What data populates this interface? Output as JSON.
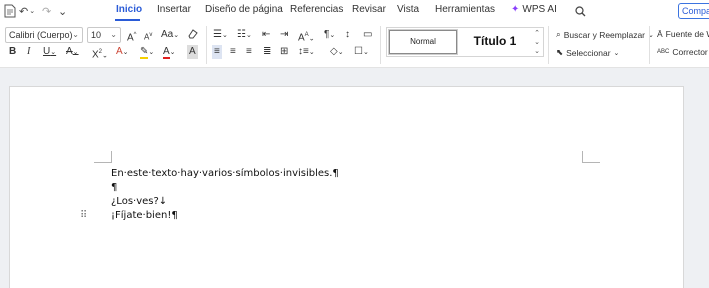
{
  "quick_access": {
    "doc_icon": "document-icon",
    "undo_icon": "undo-icon",
    "redo_icon": "redo-icon",
    "more_icon": "chevron-down-icon"
  },
  "tabs": [
    {
      "label": "Inicio",
      "active": true
    },
    {
      "label": "Insertar"
    },
    {
      "label": "Diseño de página"
    },
    {
      "label": "Referencias"
    },
    {
      "label": "Revisar"
    },
    {
      "label": "Vista"
    },
    {
      "label": "Herramientas"
    }
  ],
  "wps_ai": {
    "label": "WPS AI"
  },
  "share": {
    "label": "Compartir"
  },
  "font": {
    "family": "Calibri (Cuerpo)",
    "size": "10"
  },
  "styles": {
    "normal": "Normal",
    "title1": "Título 1"
  },
  "editing": {
    "find_replace": "Buscar y Reemplazar",
    "select": "Seleccionar",
    "font_source": "Fuente de W",
    "spell": "Corrector or"
  },
  "document": {
    "lines": [
      "En·este·texto·hay·varios·símbolos·invisibles.¶",
      "¶",
      "¿Los·ves?↓",
      "¡Fíjate·bien!¶"
    ]
  },
  "colors": {
    "accent": "#2a5bd7",
    "ai_sparkle": "#8a3ffc"
  }
}
